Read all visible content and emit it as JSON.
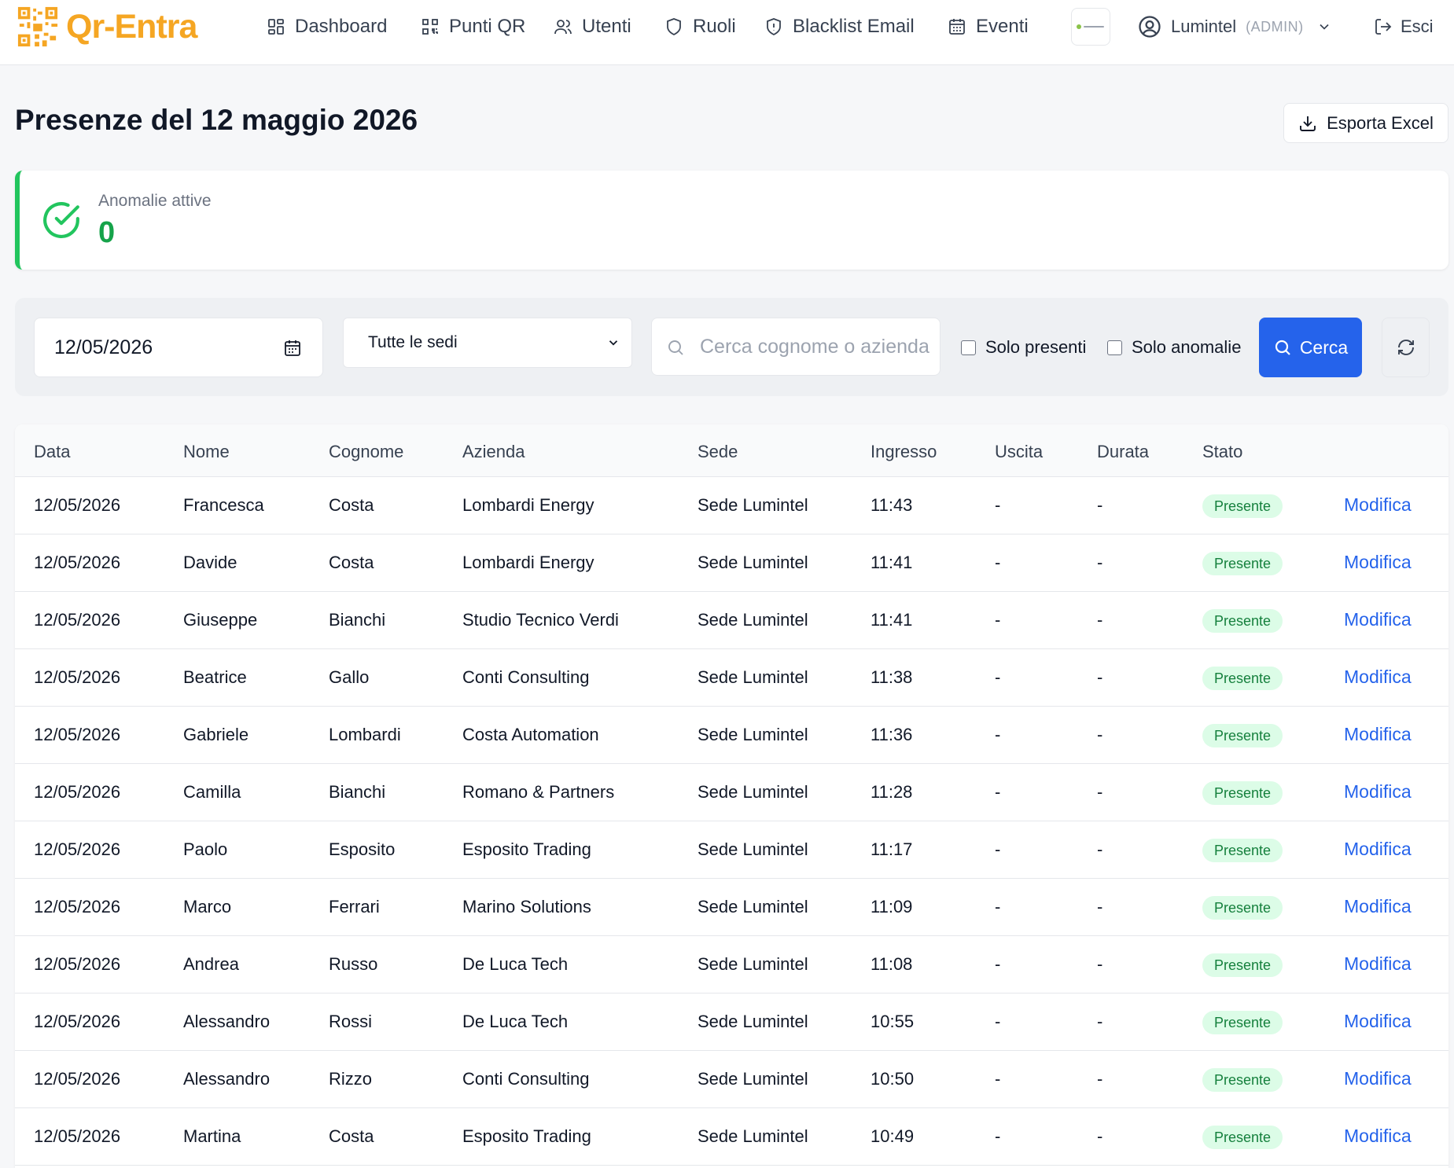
{
  "app": {
    "name": "Qr-Entra"
  },
  "nav": {
    "items": [
      {
        "label": "Dashboard",
        "icon": "dashboard-grid-icon"
      },
      {
        "label": "Punti QR",
        "icon": "qr-code-icon"
      },
      {
        "label": "Utenti",
        "icon": "users-icon"
      },
      {
        "label": "Ruoli",
        "icon": "shield-icon"
      },
      {
        "label": "Blacklist Email",
        "icon": "shield-alert-icon"
      },
      {
        "label": "Eventi",
        "icon": "calendar-icon"
      }
    ],
    "user": {
      "name": "Lumintel",
      "role": "(ADMIN)"
    },
    "logout_label": "Esci"
  },
  "header": {
    "title": "Presenze del 12 maggio 2026",
    "export_label": "Esporta Excel"
  },
  "anomalies": {
    "label": "Anomalie attive",
    "value": "0",
    "color": "#22c55e"
  },
  "filters": {
    "date": "12/05/2026",
    "sede": "Tutte le sedi",
    "search_placeholder": "Cerca cognome o azienda",
    "only_present_label": "Solo presenti",
    "only_anomalies_label": "Solo anomalie",
    "search_button": "Cerca"
  },
  "table": {
    "columns": [
      "Data",
      "Nome",
      "Cognome",
      "Azienda",
      "Sede",
      "Ingresso",
      "Uscita",
      "Durata",
      "Stato"
    ],
    "edit_label": "Modifica",
    "rows": [
      {
        "data": "12/05/2026",
        "nome": "Francesca",
        "cognome": "Costa",
        "azienda": "Lombardi Energy",
        "sede": "Sede Lumintel",
        "ingresso": "11:43",
        "uscita": "-",
        "durata": "-",
        "stato": "Presente"
      },
      {
        "data": "12/05/2026",
        "nome": "Davide",
        "cognome": "Costa",
        "azienda": "Lombardi Energy",
        "sede": "Sede Lumintel",
        "ingresso": "11:41",
        "uscita": "-",
        "durata": "-",
        "stato": "Presente"
      },
      {
        "data": "12/05/2026",
        "nome": "Giuseppe",
        "cognome": "Bianchi",
        "azienda": "Studio Tecnico Verdi",
        "sede": "Sede Lumintel",
        "ingresso": "11:41",
        "uscita": "-",
        "durata": "-",
        "stato": "Presente"
      },
      {
        "data": "12/05/2026",
        "nome": "Beatrice",
        "cognome": "Gallo",
        "azienda": "Conti Consulting",
        "sede": "Sede Lumintel",
        "ingresso": "11:38",
        "uscita": "-",
        "durata": "-",
        "stato": "Presente"
      },
      {
        "data": "12/05/2026",
        "nome": "Gabriele",
        "cognome": "Lombardi",
        "azienda": "Costa Automation",
        "sede": "Sede Lumintel",
        "ingresso": "11:36",
        "uscita": "-",
        "durata": "-",
        "stato": "Presente"
      },
      {
        "data": "12/05/2026",
        "nome": "Camilla",
        "cognome": "Bianchi",
        "azienda": "Romano & Partners",
        "sede": "Sede Lumintel",
        "ingresso": "11:28",
        "uscita": "-",
        "durata": "-",
        "stato": "Presente"
      },
      {
        "data": "12/05/2026",
        "nome": "Paolo",
        "cognome": "Esposito",
        "azienda": "Esposito Trading",
        "sede": "Sede Lumintel",
        "ingresso": "11:17",
        "uscita": "-",
        "durata": "-",
        "stato": "Presente"
      },
      {
        "data": "12/05/2026",
        "nome": "Marco",
        "cognome": "Ferrari",
        "azienda": "Marino Solutions",
        "sede": "Sede Lumintel",
        "ingresso": "11:09",
        "uscita": "-",
        "durata": "-",
        "stato": "Presente"
      },
      {
        "data": "12/05/2026",
        "nome": "Andrea",
        "cognome": "Russo",
        "azienda": "De Luca Tech",
        "sede": "Sede Lumintel",
        "ingresso": "11:08",
        "uscita": "-",
        "durata": "-",
        "stato": "Presente"
      },
      {
        "data": "12/05/2026",
        "nome": "Alessandro",
        "cognome": "Rossi",
        "azienda": "De Luca Tech",
        "sede": "Sede Lumintel",
        "ingresso": "10:55",
        "uscita": "-",
        "durata": "-",
        "stato": "Presente"
      },
      {
        "data": "12/05/2026",
        "nome": "Alessandro",
        "cognome": "Rizzo",
        "azienda": "Conti Consulting",
        "sede": "Sede Lumintel",
        "ingresso": "10:50",
        "uscita": "-",
        "durata": "-",
        "stato": "Presente"
      },
      {
        "data": "12/05/2026",
        "nome": "Martina",
        "cognome": "Costa",
        "azienda": "Esposito Trading",
        "sede": "Sede Lumintel",
        "ingresso": "10:49",
        "uscita": "-",
        "durata": "-",
        "stato": "Presente"
      }
    ]
  }
}
